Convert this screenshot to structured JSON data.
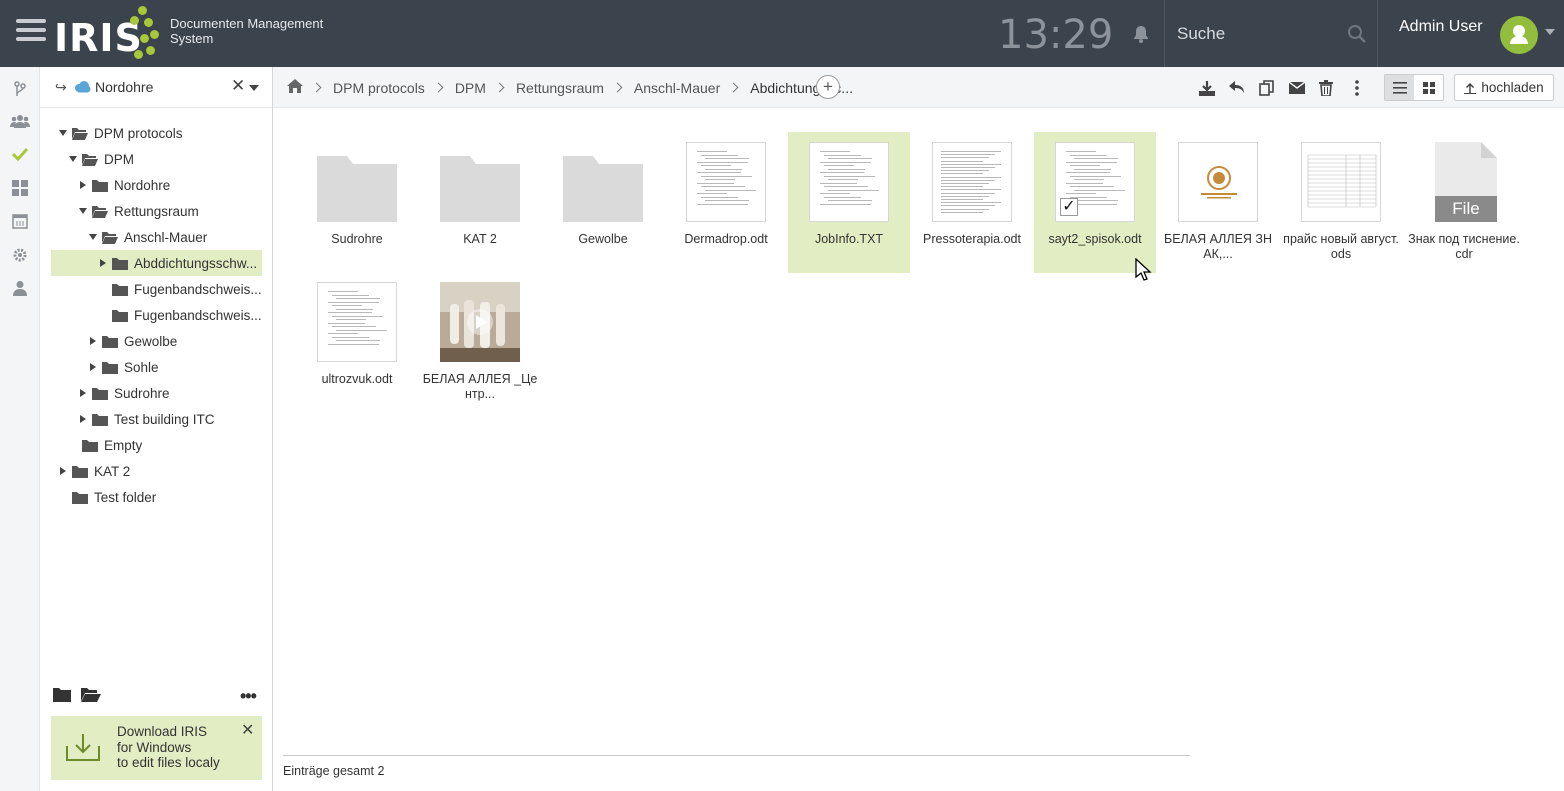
{
  "app": {
    "logo": "IRIS",
    "subtitle_line1": "Documenten Management",
    "subtitle_line2": "System",
    "clock": "13:29",
    "search_placeholder": "Suche",
    "user_name": "Admin User",
    "accent_color": "#a6c83a",
    "header_color": "#3b434d"
  },
  "rail_icons": [
    "branch-icon",
    "users-icon",
    "check-icon",
    "dashboard-icon",
    "calendar-icon",
    "gear-icon",
    "user-icon"
  ],
  "sidebar": {
    "title": "Nordohre",
    "tree": [
      {
        "label": "DPM protocols",
        "expanded": true,
        "selected": false
      },
      {
        "label": "DPM",
        "expanded": true,
        "selected": false
      },
      {
        "label": "Nordohre",
        "expanded": false,
        "selected": false
      },
      {
        "label": "Rettungsraum",
        "expanded": true,
        "selected": false
      },
      {
        "label": "Anschl-Mauer",
        "expanded": true,
        "selected": false
      },
      {
        "label": "Abddichtungsschw...",
        "expanded": false,
        "selected": true
      },
      {
        "label": "Fugenbandschweis...",
        "expanded": null,
        "selected": false
      },
      {
        "label": "Fugenbandschweis...",
        "expanded": null,
        "selected": false
      },
      {
        "label": "Gewolbe",
        "expanded": false,
        "selected": false
      },
      {
        "label": "Sohle",
        "expanded": false,
        "selected": false
      },
      {
        "label": "Sudrohre",
        "expanded": false,
        "selected": false
      },
      {
        "label": "Test building ITC",
        "expanded": false,
        "selected": false
      },
      {
        "label": "Empty",
        "expanded": null,
        "selected": false
      },
      {
        "label": "KAT 2",
        "expanded": false,
        "selected": false
      },
      {
        "label": "Test folder",
        "expanded": null,
        "selected": false
      }
    ],
    "download": {
      "line1": "Download IRIS",
      "line2": "for Windows",
      "line3": "to edit files localy"
    }
  },
  "breadcrumb": [
    "DPM protocols",
    "DPM",
    "Rettungsraum",
    "Anschl-Mauer",
    "Abdichtungssc..."
  ],
  "toolbar": {
    "upload_label": "hochladen",
    "view_mode": "list"
  },
  "files": [
    {
      "name": "Sudrohre",
      "type": "folder",
      "selected": false
    },
    {
      "name": "KAT 2",
      "type": "folder",
      "selected": false
    },
    {
      "name": "Gewolbe",
      "type": "folder",
      "selected": false
    },
    {
      "name": "Dermadrop.odt",
      "type": "doc",
      "selected": false
    },
    {
      "name": "JobInfo.TXT",
      "type": "doc",
      "selected": true
    },
    {
      "name": "Pressoterapia.odt",
      "type": "doc",
      "selected": false
    },
    {
      "name": "sayt2_spisok.odt",
      "type": "doc",
      "selected": true,
      "checked": true
    },
    {
      "name": "БЕЛАЯ АЛЛЕЯ ЗНАК,...",
      "type": "image",
      "selected": false
    },
    {
      "name": "прайс новый август.ods",
      "type": "sheet",
      "selected": false
    },
    {
      "name": "Знак под тиснение.cdr",
      "type": "generic",
      "badge": "File",
      "selected": false
    },
    {
      "name": "ultrozvuk.odt",
      "type": "doc",
      "selected": false
    },
    {
      "name": "БЕЛАЯ АЛЛЕЯ _Центр...",
      "type": "video",
      "selected": false
    }
  ],
  "footer": {
    "total_label": "Einträge gesamt 2"
  }
}
